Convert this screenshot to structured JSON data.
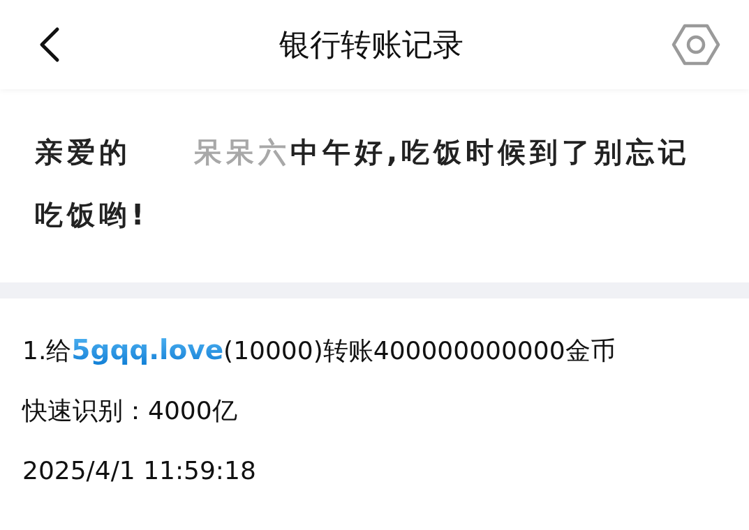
{
  "header": {
    "title": "银行转账记录"
  },
  "greeting": {
    "salutation": "亲爱的",
    "name": "呆呆六",
    "message": "中午好,吃饭时候到了别忘记吃饭哟!"
  },
  "records": [
    {
      "prefix": "1.给",
      "recipient": "5gqq.love",
      "detail": "(10000)转账400000000000金币",
      "quick": "快速识别：4000亿",
      "time": "2025/4/1 11:59:18"
    }
  ]
}
